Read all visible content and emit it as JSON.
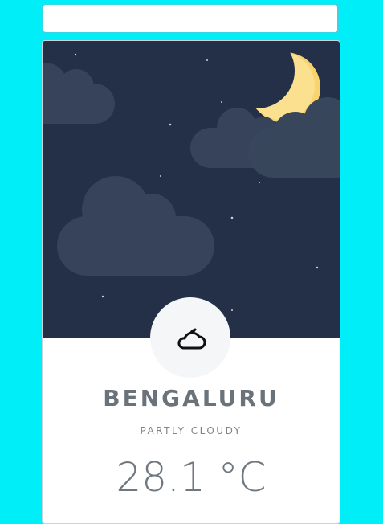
{
  "search": {
    "value": "",
    "placeholder": ""
  },
  "weather": {
    "city": "BENGALURU",
    "condition": "PARTLY CLOUDY",
    "temperature": "28.1",
    "unit": "°C",
    "icon": "cloud-moon-icon"
  },
  "scene": {
    "sky_color": "#243047",
    "cloud_color": "#36435a",
    "moon_color": "#fbe08f",
    "badge_color": "#f4f6f7"
  },
  "colors": {
    "background": "#00eef8",
    "text": "#6b737a"
  }
}
